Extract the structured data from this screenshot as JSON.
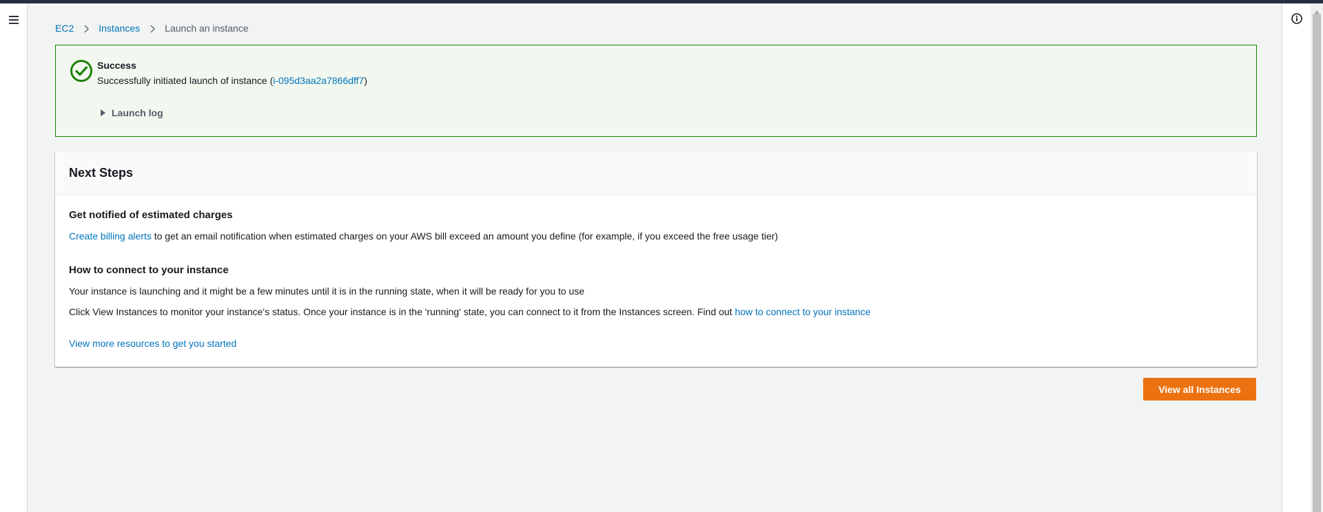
{
  "breadcrumb": {
    "items": [
      "EC2",
      "Instances"
    ],
    "current": "Launch an instance"
  },
  "flash": {
    "title": "Success",
    "message_prefix": "Successfully initiated launch of instance (",
    "instance_id": "i-095d3aa2a7866dff7",
    "message_suffix": ")",
    "launch_log_label": "Launch log"
  },
  "next_steps": {
    "title": "Next Steps",
    "billing": {
      "heading": "Get notified of estimated charges",
      "link_text": "Create billing alerts",
      "text": " to get an email notification when estimated charges on your AWS bill exceed an amount you define (for example, if you exceed the free usage tier)"
    },
    "connect": {
      "heading": "How to connect to your instance",
      "line1": "Your instance is launching and it might be a few minutes until it is in the running state, when it will be ready for you to use",
      "line2_text": "Click View Instances to monitor your instance's status. Once your instance is in the 'running' state, you can connect to it from the Instances screen. Find out ",
      "line2_link": "how to connect to your instance"
    },
    "resources_link": "View more resources to get you started"
  },
  "actions": {
    "view_all_label": "View all Instances"
  },
  "icons": {
    "menu": "hamburger-menu-icon",
    "info": "info-icon",
    "success": "success-check-icon",
    "breadcrumb_separator": "chevron-right-icon"
  },
  "colors": {
    "link": "#0073bb",
    "success": "#1d8102",
    "primary_button": "#ec7211",
    "top_bar": "#232f3e"
  }
}
